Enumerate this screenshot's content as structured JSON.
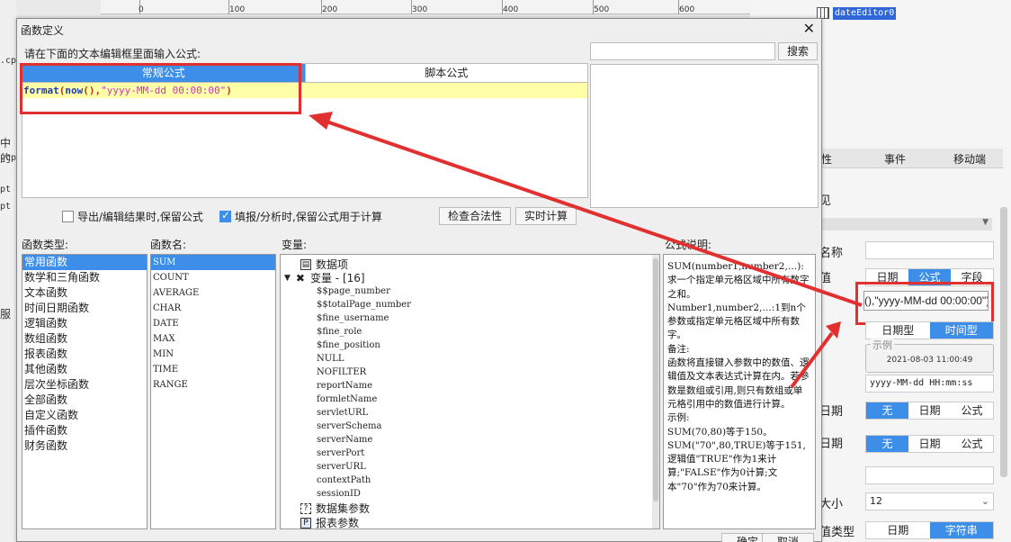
{
  "background": {
    "ruler_ticks": [
      "0",
      "100",
      "200",
      "300",
      "400",
      "500",
      "600"
    ],
    "ruler_icon": "E0",
    "left_edge_texts": [
      ".cp",
      "中的",
      ".cp",
      "pt",
      "pt",
      "服"
    ],
    "component_name": "dateEditor0",
    "tabs": [
      "性",
      "事件",
      "移动端"
    ],
    "label_1": "见",
    "label_2": "名称",
    "label_3": "值",
    "value_segments": [
      "日期",
      "公式",
      "字段"
    ],
    "formula_value": "(),\"yyyy-MM-dd 00:00:00\")",
    "type_segments": [
      "日期型",
      "时间型"
    ],
    "example_title": "示例",
    "example_value": "2021-08-03 11:00:49",
    "format_value": "yyyy-MM-dd HH:mm:ss",
    "label_4": "日期",
    "label_5": "日期",
    "start_segments": [
      "无",
      "日期",
      "公式"
    ],
    "end_segments": [
      "无",
      "日期",
      "公式"
    ],
    "label_6": "大小",
    "size_value": "12",
    "label_7": "值类型",
    "valuetype_segments": [
      "日期",
      "字符串"
    ]
  },
  "dialog": {
    "title": "函数定义",
    "close": "✕",
    "prompt": "请在下面的文本编辑框里面输入公式:",
    "tabs": [
      "常规公式",
      "脚本公式"
    ],
    "formula": {
      "fn1": "format",
      "p1": "(",
      "fn2": "now",
      "p2": "(),",
      "str": "\"yyyy-MM-dd 00:00:00\"",
      "p3": ")"
    },
    "search_button": "搜索",
    "checkbox_export": "导出/编辑结果时,保留公式",
    "checkbox_fill": "填报/分析时,保留公式用于计算",
    "check_button": "检查合法性",
    "realtime_button": "实时计算",
    "labels": {
      "fn_type": "函数类型:",
      "fn_name": "函数名:",
      "vars": "变量:",
      "desc": "公式说明:"
    },
    "function_types": [
      "常用函数",
      "数学和三角函数",
      "文本函数",
      "时间日期函数",
      "逻辑函数",
      "数组函数",
      "报表函数",
      "其他函数",
      "层次坐标函数",
      "全部函数",
      "自定义函数",
      "插件函数",
      "财务函数"
    ],
    "function_names": [
      "SUM",
      "COUNT",
      "AVERAGE",
      "CHAR",
      "DATE",
      "MAX",
      "MIN",
      "TIME",
      "RANGE"
    ],
    "vars_tree": {
      "data_item": "数据项",
      "variables": "变量 - [16]",
      "items": [
        "$$page_number",
        "$$totalPage_number",
        "$fine_username",
        "$fine_role",
        "$fine_position",
        "NULL",
        "NOFILTER",
        "reportName",
        "formletName",
        "servletURL",
        "serverSchema",
        "serverName",
        "serverPort",
        "serverURL",
        "contextPath",
        "sessionID"
      ],
      "dataset_params": "数据集参数",
      "report_params": "报表参数"
    },
    "description": [
      "SUM(number1,number2,…):求一个指定单元格区域中所有数字之和。",
      "Number1,number2,…:1到n个参数或指定单元格区域中所有数字。",
      "备注:",
      "函数将直接键入参数中的数值、逻辑值及文本表达式计算在内。若参数是数组或引用,则只有数组或单元格引用中的数值进行计算。",
      "示例:",
      "SUM(70,80)等于150。",
      "SUM(\"70\",80,TRUE)等于151,逻辑值\"TRUE\"作为1来计算;\"FALSE\"作为0计算;文本\"70\"作为70来计算。"
    ],
    "ok": "确定",
    "cancel": "取消"
  },
  "colors": {
    "accent": "#3d8ee8",
    "highlight_red": "#e23030",
    "code_line_bg": "#ffffa8"
  }
}
